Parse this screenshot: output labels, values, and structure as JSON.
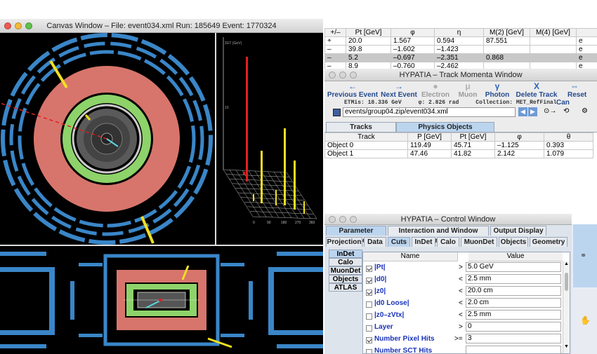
{
  "canvas_window": {
    "title": "Canvas Window –  File: event034.xml   Run: 185649   Event: 1770324",
    "lego_axis": {
      "ylabel": "ΣET (GeV)",
      "y_ticks": [
        "10"
      ],
      "x_ticks": [
        "0",
        "90",
        "180",
        "270",
        "360"
      ]
    }
  },
  "particle_table": {
    "headers": [
      "+/–",
      "Pt [GeV]",
      "φ",
      "η",
      "M(2) [GeV]",
      "M(4) [GeV]",
      ""
    ],
    "rows": [
      [
        "+",
        "20.0",
        "1.567",
        "0.594",
        "87.551",
        "",
        "e"
      ],
      [
        "–",
        "39.8",
        "–1.602",
        "–1.423",
        "",
        "",
        "e"
      ],
      [
        "–",
        "5.2",
        "–0.697",
        "–2.351",
        "0.868",
        "",
        "e"
      ],
      [
        "–",
        "8.9",
        "–0.760",
        "–2.462",
        "",
        "",
        "e"
      ]
    ]
  },
  "track_window": {
    "title": "HYPATIA – Track Momenta Window",
    "toolbar": [
      {
        "label": "Previous Event",
        "icon": "←",
        "icon_name": "left-arrow-icon",
        "enabled": true
      },
      {
        "label": "Next Event",
        "icon": "→",
        "icon_name": "right-arrow-icon",
        "enabled": true
      },
      {
        "label": "Electron",
        "icon": "●",
        "icon_name": "electron-icon",
        "enabled": false
      },
      {
        "label": "Muon",
        "icon": "μ",
        "icon_name": "muon-icon",
        "enabled": false
      },
      {
        "label": "Photon",
        "icon": "γ",
        "icon_name": "photon-icon",
        "enabled": true
      },
      {
        "label": "Delete Track",
        "icon": "X",
        "icon_name": "delete-icon",
        "enabled": true
      },
      {
        "label": "Reset Can",
        "icon": "⇔",
        "icon_name": "reset-icon",
        "enabled": true
      }
    ],
    "etmiss": "ETMis: 18.336 GeV",
    "phi": "φ: 2.826 rad",
    "collection": "Collection: MET_RefFinal",
    "file_path": "events/group04.zip/event034.xml",
    "tabs": [
      "Tracks",
      "Physics Objects"
    ],
    "selected_tab": 1,
    "objects_headers": [
      "Track",
      "P [GeV]",
      "Pt [GeV]",
      "φ",
      "θ"
    ],
    "objects_rows": [
      [
        "Object 0",
        "119.49",
        "45.71",
        "–1.125",
        "0.393"
      ],
      [
        "Object 1",
        "47.46",
        "41.82",
        "2.142",
        "1.079"
      ]
    ]
  },
  "control_window": {
    "title": "HYPATIA – Control Window",
    "main_tabs": [
      "Parameter Control",
      "Interaction and Window Control",
      "Output Display"
    ],
    "sub_tabs": [
      "Projection",
      "Data",
      "Cuts",
      "InDet",
      "Calo",
      "MuonDet",
      "Objects",
      "Geometry"
    ],
    "side_tabs": [
      "InDet",
      "Calo",
      "MuonDet",
      "Objects",
      "ATLAS"
    ],
    "cuts_headers": [
      "Name",
      "Value"
    ],
    "cuts": [
      {
        "checked": true,
        "name": "|Pt|",
        "op": ">",
        "value": "5.0 GeV"
      },
      {
        "checked": true,
        "name": "|d0|",
        "op": "<",
        "value": "2.5 mm"
      },
      {
        "checked": true,
        "name": "|z0|",
        "op": "<",
        "value": "20.0 cm"
      },
      {
        "checked": false,
        "name": "|d0 Loose|",
        "op": "<",
        "value": "2.0 cm"
      },
      {
        "checked": false,
        "name": "|z0–zVtx|",
        "op": "<",
        "value": "2.5 mm"
      },
      {
        "checked": false,
        "name": "Layer",
        "op": ">",
        "value": "0"
      },
      {
        "checked": true,
        "name": "Number Pixel Hits",
        "op": ">=",
        "value": "3"
      },
      {
        "checked": false,
        "name": "Number SCT Hits",
        "op": "",
        "value": ""
      }
    ]
  }
}
